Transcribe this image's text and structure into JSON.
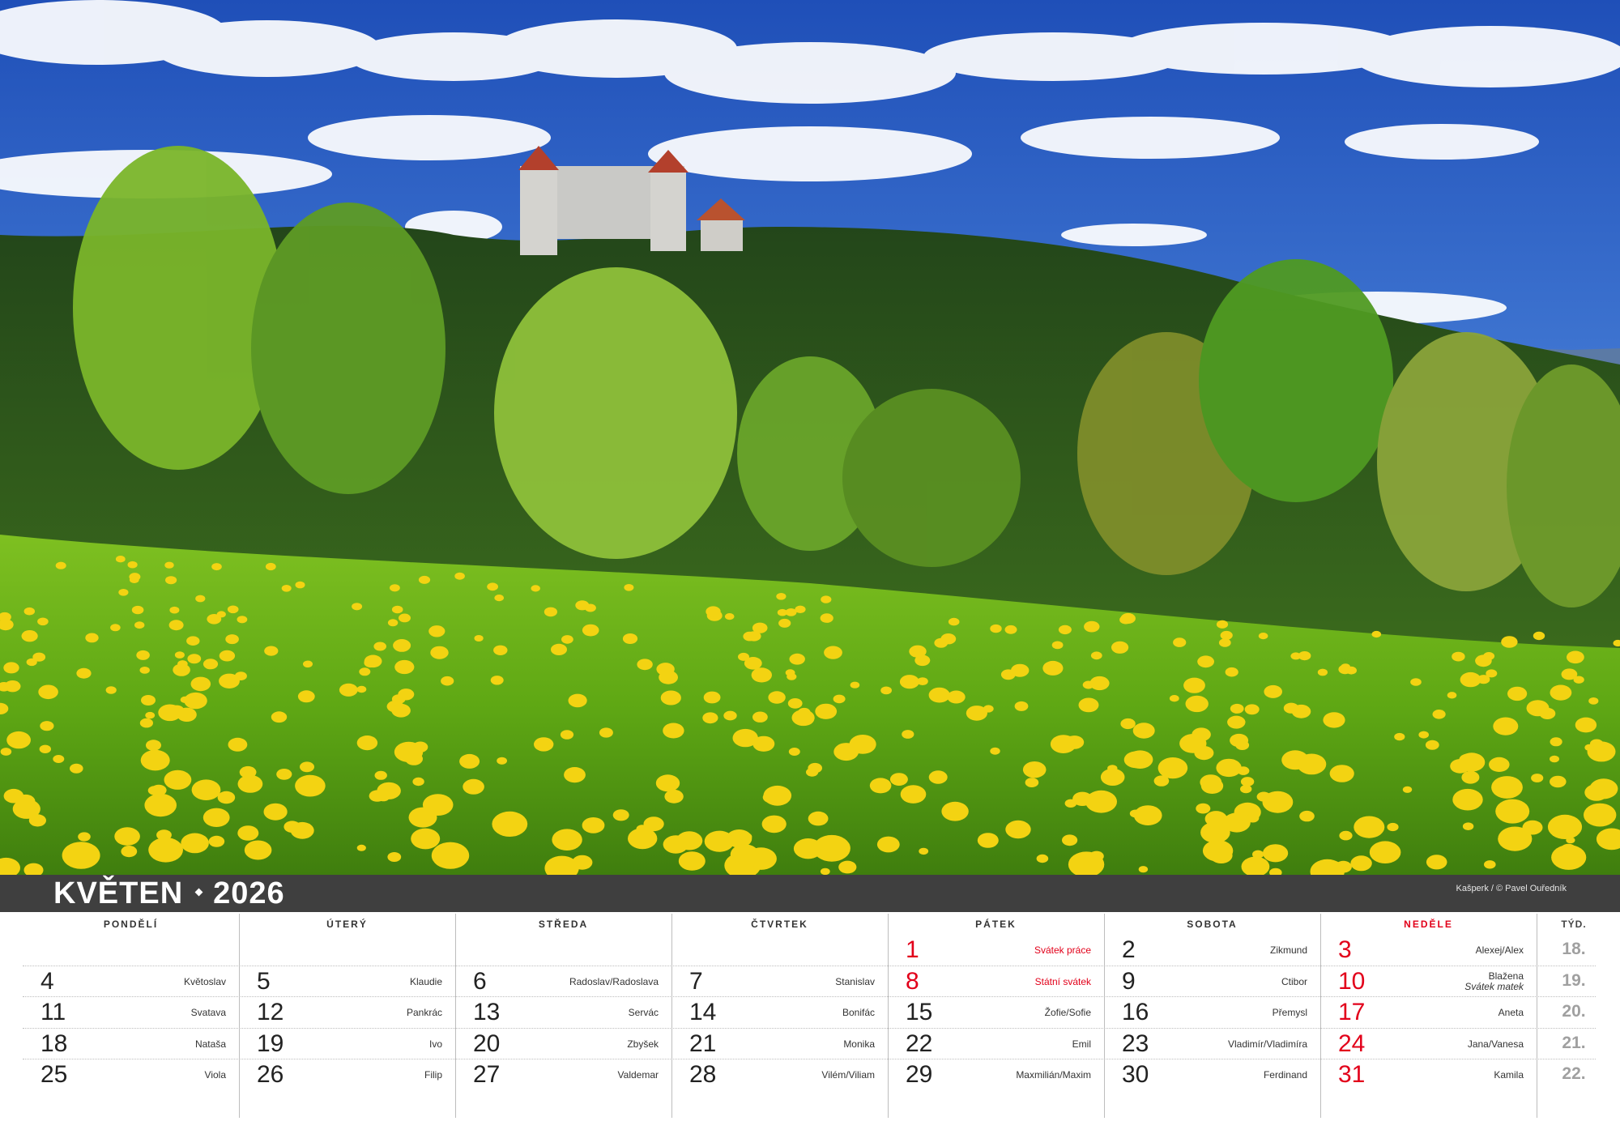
{
  "photo": {
    "caption": "Kašperk / © Pavel Ouředník",
    "colors": {
      "sky": "#2f63c8",
      "meadow": "#6fb51f",
      "forest": "#2f5a18",
      "flowers": "#f3d312"
    }
  },
  "header": {
    "month": "KVĚTEN",
    "year": "2026"
  },
  "weekdays": [
    "PONDĚLÍ",
    "ÚTERÝ",
    "STŘEDA",
    "ČTVRTEK",
    "PÁTEK",
    "SOBOTA",
    "NEDĚLE"
  ],
  "week_label": "TÝD.",
  "weeks": [
    {
      "week_no": "18.",
      "days": [
        null,
        null,
        null,
        null,
        {
          "day": "1",
          "name": "Svátek práce",
          "holiday": true
        },
        {
          "day": "2",
          "name": "Zikmund"
        },
        {
          "day": "3",
          "name": "Alexej/Alex"
        }
      ]
    },
    {
      "week_no": "19.",
      "days": [
        {
          "day": "4",
          "name": "Květoslav"
        },
        {
          "day": "5",
          "name": "Klaudie"
        },
        {
          "day": "6",
          "name": "Radoslav/Radoslava"
        },
        {
          "day": "7",
          "name": "Stanislav"
        },
        {
          "day": "8",
          "name": "Státní svátek",
          "holiday": true
        },
        {
          "day": "9",
          "name": "Ctibor"
        },
        {
          "day": "10",
          "name": "Blažena",
          "note": "Svátek matek"
        }
      ]
    },
    {
      "week_no": "20.",
      "days": [
        {
          "day": "11",
          "name": "Svatava"
        },
        {
          "day": "12",
          "name": "Pankrác"
        },
        {
          "day": "13",
          "name": "Servác"
        },
        {
          "day": "14",
          "name": "Bonifác"
        },
        {
          "day": "15",
          "name": "Žofie/Sofie"
        },
        {
          "day": "16",
          "name": "Přemysl"
        },
        {
          "day": "17",
          "name": "Aneta"
        }
      ]
    },
    {
      "week_no": "21.",
      "days": [
        {
          "day": "18",
          "name": "Nataša"
        },
        {
          "day": "19",
          "name": "Ivo"
        },
        {
          "day": "20",
          "name": "Zbyšek"
        },
        {
          "day": "21",
          "name": "Monika"
        },
        {
          "day": "22",
          "name": "Emil"
        },
        {
          "day": "23",
          "name": "Vladimír/Vladimíra"
        },
        {
          "day": "24",
          "name": "Jana/Vanesa"
        }
      ]
    },
    {
      "week_no": "22.",
      "days": [
        {
          "day": "25",
          "name": "Viola"
        },
        {
          "day": "26",
          "name": "Filip"
        },
        {
          "day": "27",
          "name": "Valdemar"
        },
        {
          "day": "28",
          "name": "Vilém/Viliam"
        },
        {
          "day": "29",
          "name": "Maxmilián/Maxim"
        },
        {
          "day": "30",
          "name": "Ferdinand"
        },
        {
          "day": "31",
          "name": "Kamila"
        }
      ]
    }
  ]
}
